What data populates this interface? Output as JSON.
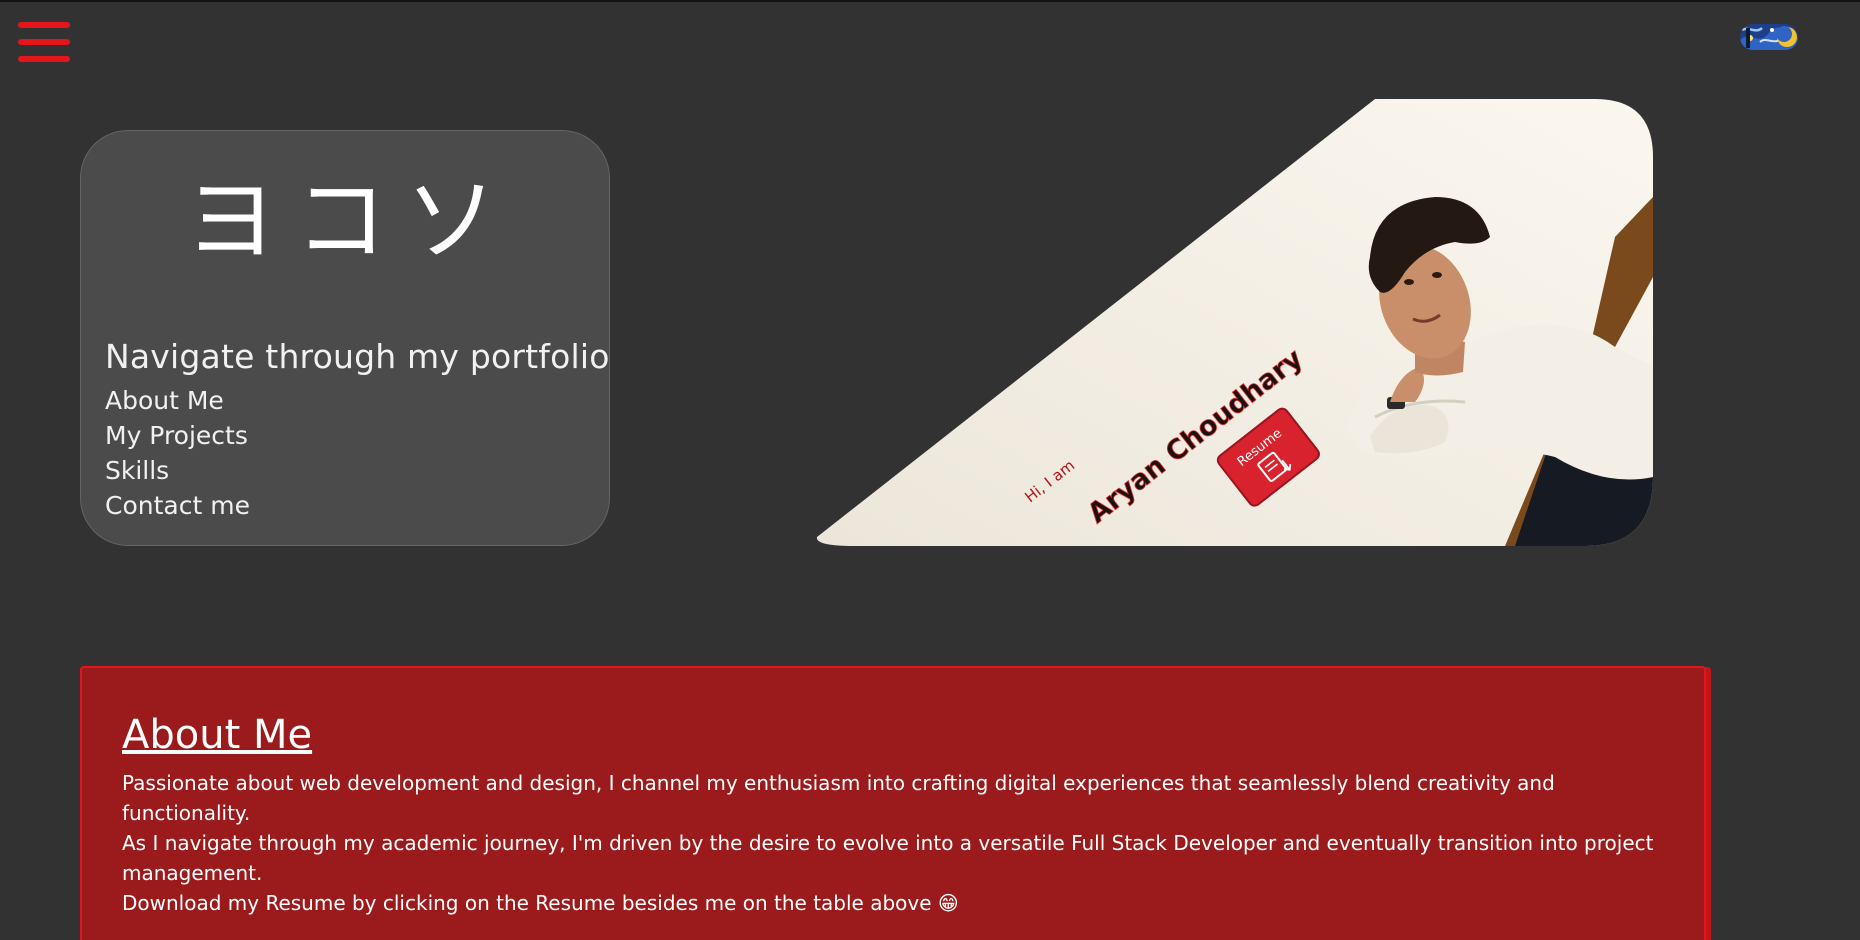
{
  "header": {
    "menu_icon": "hamburger-menu-icon",
    "theme_toggle_icon": "starry-night-theme-toggle-icon"
  },
  "nav_card": {
    "kana": "ヨコソ",
    "heading": "Navigate through my portfolio",
    "links": [
      "About Me",
      "My Projects",
      "Skills",
      "Contact me"
    ]
  },
  "hero": {
    "greeting": "Hi, I am",
    "name": "Aryan Choudhary",
    "resume_label": "Resume",
    "resume_icon": "document-download-icon"
  },
  "about": {
    "title": "About Me",
    "paragraphs": [
      "Passionate about web development and design, I channel my enthusiasm into crafting digital experiences that seamlessly blend creativity and functionality.",
      "As I navigate through my academic journey, I'm driven by the desire to evolve into a versatile Full Stack Developer and eventually transition into project management.",
      "Download my Resume by clicking on the Resume besides me on the table above 😁"
    ]
  },
  "colors": {
    "background": "#323232",
    "accent": "#e4161c",
    "about_bg": "#9b1a1c",
    "card_bg": "#4b4b4b"
  }
}
